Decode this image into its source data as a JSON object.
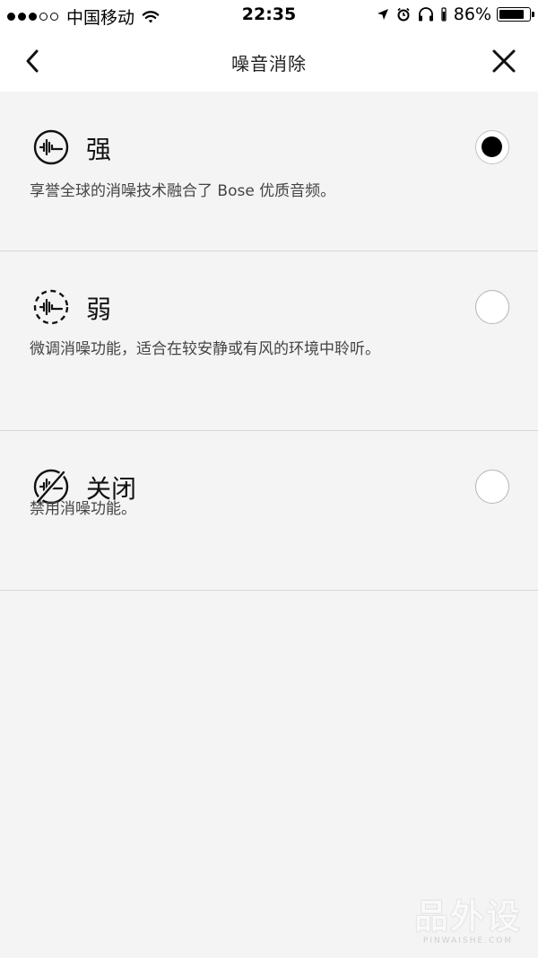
{
  "status_bar": {
    "signal_dots_full": 3,
    "signal_dots_empty": 2,
    "carrier": "中国移动",
    "time": "22:35",
    "battery_percent": "86%",
    "battery_level": 0.86
  },
  "nav": {
    "title": "噪音消除",
    "back_icon": "chevron-left-icon",
    "close_icon": "close-icon"
  },
  "options": [
    {
      "title": "强",
      "description": "享誉全球的消噪技术融合了 Bose 优质音频。",
      "icon": "noise-cancel-high-icon",
      "selected": true
    },
    {
      "title": "弱",
      "description": "微调消噪功能，适合在较安静或有风的环境中聆听。",
      "icon": "noise-cancel-low-icon",
      "selected": false
    },
    {
      "title": "关闭",
      "description": "禁用消噪功能。",
      "icon": "noise-cancel-off-icon",
      "selected": false
    }
  ],
  "watermark": {
    "main": "品外设",
    "sub": "PINWAISHE.COM"
  },
  "colors": {
    "background": "#f4f4f4",
    "bar": "#ffffff",
    "divider": "#d6d6d6",
    "radio_selected": "#000000"
  }
}
